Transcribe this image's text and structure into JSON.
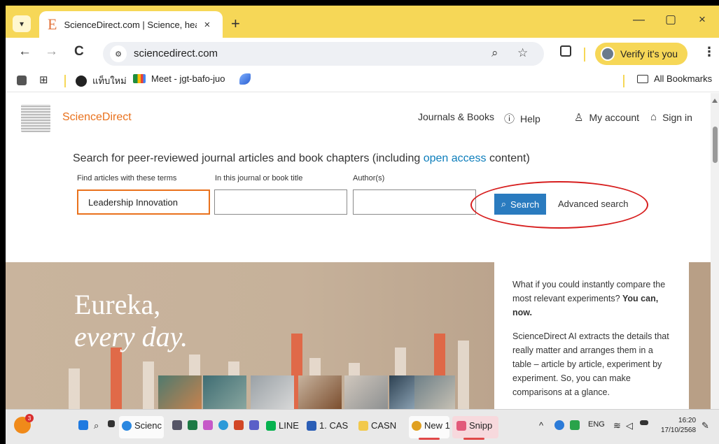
{
  "browser": {
    "tab_title": "ScienceDirect.com | Science, healt",
    "tab_favicon": "E",
    "url": "sciencedirect.com",
    "verify_label": "Verify it's you",
    "new_tab": "+",
    "close_tab": "×",
    "win_minimize": "—",
    "win_restore": "▢",
    "win_close": "×",
    "nav_back": "←",
    "nav_forward": "→",
    "nav_reload": "C",
    "kebab": "⋮",
    "bookmarks": [
      {
        "label": "แท็บใหม่"
      },
      {
        "label": "Meet - jgt-bafo-juo"
      }
    ],
    "all_bookmarks": "All Bookmarks"
  },
  "header": {
    "brand": "ScienceDirect",
    "nav": {
      "journals": "Journals & Books",
      "help": "Help",
      "account": "My account",
      "signin": "Sign in"
    }
  },
  "search": {
    "heading_pre": "Search for peer-reviewed journal articles and book chapters (including ",
    "heading_link": "open access",
    "heading_post": " content)",
    "terms_label": "Find articles with these terms",
    "terms_value": "Leadership Innovation",
    "journal_label": "In this journal or book title",
    "journal_value": "",
    "author_label": "Author(s)",
    "author_value": "",
    "button": "Search",
    "advanced": "Advanced search"
  },
  "hero": {
    "line1": "Eureka,",
    "line2": "every day.",
    "p1_pre": "What if you could instantly compare the most relevant experiments? ",
    "p1_bold": "You can, now.",
    "p2": "ScienceDirect AI extracts the details that really matter and arranges them in a table – article by article, experiment by experiment. So, you can make comparisons at a glance."
  },
  "taskbar": {
    "weather_badge": "3",
    "items": [
      {
        "label": "Scienc"
      },
      {
        "label": "LINE"
      },
      {
        "label": "1. CAS"
      },
      {
        "label": "CASN"
      },
      {
        "label": "New 1"
      },
      {
        "label": "Snipp"
      }
    ],
    "lang": "ENG",
    "time": "16:20",
    "date": "17/10/2568"
  },
  "colors": {
    "tabbar": "#f6d757",
    "brand_orange": "#e9711c",
    "search_blue": "#2a7bbf",
    "annotation_red": "#d71e1e"
  }
}
